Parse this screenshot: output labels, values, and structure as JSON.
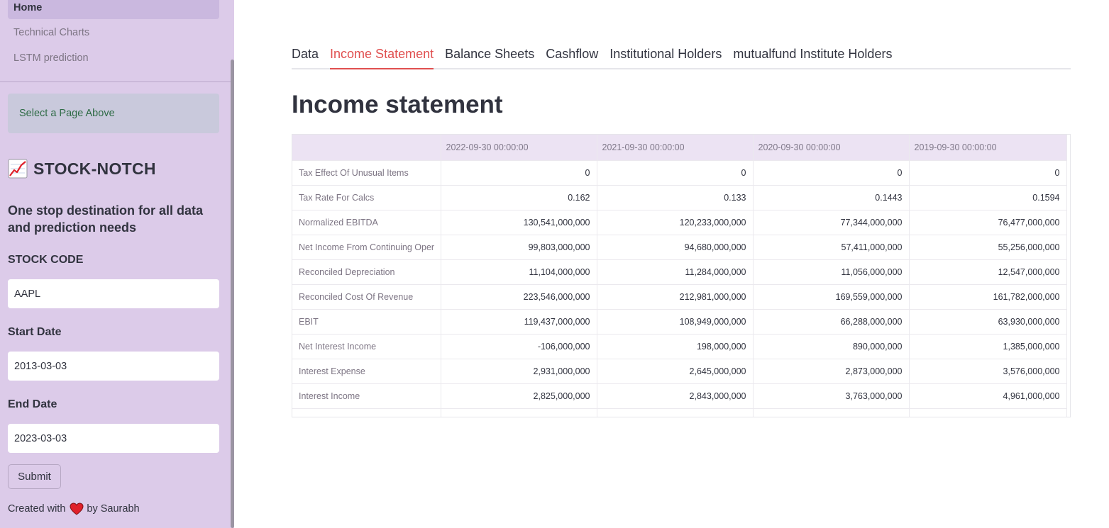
{
  "sidebar": {
    "nav": [
      "Home",
      "Technical Charts",
      "LSTM prediction"
    ],
    "info": "Select a Page Above",
    "brand": "STOCK-NOTCH",
    "brand_icon": "chart-increasing-icon",
    "tagline": "One stop destination for all data and prediction needs",
    "stock_code_label": "STOCK CODE",
    "stock_code_value": "AAPL",
    "start_date_label": "Start Date",
    "start_date_value": "2013-03-03",
    "end_date_label": "End Date",
    "end_date_value": "2023-03-03",
    "submit_label": "Submit",
    "footer_prefix": "Created with",
    "footer_suffix": "by Saurabh",
    "heart_color": "#e0202a"
  },
  "tabs": [
    "Data",
    "Income Statement",
    "Balance Sheets",
    "Cashflow",
    "Institutional Holders",
    "mutualfund Institute Holders"
  ],
  "active_tab": "Income Statement",
  "accent_color": "#e04f4f",
  "page_title": "Income statement",
  "table": {
    "columns": [
      "2022-09-30 00:00:00",
      "2021-09-30 00:00:00",
      "2020-09-30 00:00:00",
      "2019-09-30 00:00:00"
    ],
    "rows": [
      {
        "label": "Tax Effect Of Unusual Items",
        "values": [
          "0",
          "0",
          "0",
          "0"
        ]
      },
      {
        "label": "Tax Rate For Calcs",
        "values": [
          "0.162",
          "0.133",
          "0.1443",
          "0.1594"
        ]
      },
      {
        "label": "Normalized EBITDA",
        "values": [
          "130,541,000,000",
          "120,233,000,000",
          "77,344,000,000",
          "76,477,000,000"
        ]
      },
      {
        "label": "Net Income From Continuing Oper",
        "values": [
          "99,803,000,000",
          "94,680,000,000",
          "57,411,000,000",
          "55,256,000,000"
        ]
      },
      {
        "label": "Reconciled Depreciation",
        "values": [
          "11,104,000,000",
          "11,284,000,000",
          "11,056,000,000",
          "12,547,000,000"
        ]
      },
      {
        "label": "Reconciled Cost Of Revenue",
        "values": [
          "223,546,000,000",
          "212,981,000,000",
          "169,559,000,000",
          "161,782,000,000"
        ]
      },
      {
        "label": "EBIT",
        "values": [
          "119,437,000,000",
          "108,949,000,000",
          "66,288,000,000",
          "63,930,000,000"
        ]
      },
      {
        "label": "Net Interest Income",
        "values": [
          "-106,000,000",
          "198,000,000",
          "890,000,000",
          "1,385,000,000"
        ]
      },
      {
        "label": "Interest Expense",
        "values": [
          "2,931,000,000",
          "2,645,000,000",
          "2,873,000,000",
          "3,576,000,000"
        ]
      },
      {
        "label": "Interest Income",
        "values": [
          "2,825,000,000",
          "2,843,000,000",
          "3,763,000,000",
          "4,961,000,000"
        ]
      }
    ]
  }
}
